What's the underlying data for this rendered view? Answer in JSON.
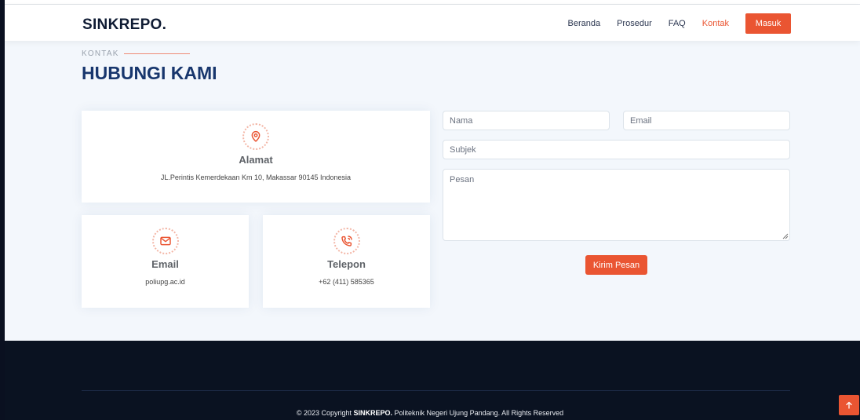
{
  "brand": {
    "logo": "SINKREPO."
  },
  "nav": {
    "items": [
      {
        "label": "Beranda"
      },
      {
        "label": "Prosedur"
      },
      {
        "label": "FAQ"
      },
      {
        "label": "Kontak",
        "active": true
      }
    ],
    "login_label": "Masuk"
  },
  "section": {
    "label": "KONTAK",
    "title": "HUBUNGI KAMI"
  },
  "contact_cards": {
    "address": {
      "icon": "map-pin-icon",
      "title": "Alamat",
      "text": "JL.Perintis Kemerdekaan Km 10, Makassar 90145 Indonesia"
    },
    "email": {
      "icon": "envelope-icon",
      "title": "Email",
      "text": "poliupg.ac.id"
    },
    "phone": {
      "icon": "phone-call-icon",
      "title": "Telepon",
      "text": "+62 (411) 585365"
    }
  },
  "form": {
    "name_placeholder": "Nama",
    "email_placeholder": "Email",
    "subject_placeholder": "Subjek",
    "message_placeholder": "Pesan",
    "submit_label": "Kirim Pesan"
  },
  "footer": {
    "copyright_prefix": "© 2023 Copyright ",
    "copyright_brand": "SINKREPO.",
    "copyright_suffix": " Politeknik Negeri Ujung Pandang. All Rights Reserved"
  },
  "colors": {
    "accent": "#ea5532",
    "title": "#17366d",
    "footer_bg": "#0a1221"
  }
}
